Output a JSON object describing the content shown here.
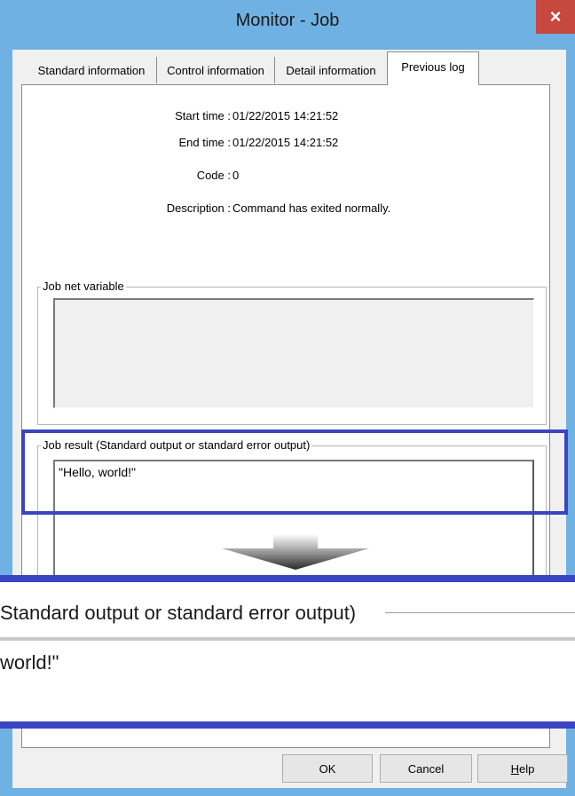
{
  "window": {
    "title": "Monitor - Job",
    "close_glyph": "×"
  },
  "tabs": [
    {
      "label": "Standard information",
      "active": false
    },
    {
      "label": "Control information",
      "active": false
    },
    {
      "label": "Detail information",
      "active": false
    },
    {
      "label": "Previous log",
      "active": true
    }
  ],
  "info": {
    "start_time_label": "Start time :",
    "start_time_value": "01/22/2015 14:21:52",
    "end_time_label": "End time :",
    "end_time_value": "01/22/2015 14:21:52",
    "code_label": "Code :",
    "code_value": "0",
    "description_label": "Description :",
    "description_value": "Command has exited normally."
  },
  "job_net_variable": {
    "title": "Job net variable",
    "value": ""
  },
  "job_result": {
    "title": "Job result (Standard output or standard error output)",
    "value": "\"Hello, world!\""
  },
  "zoom_callout": {
    "title_fragment": "Standard output or standard error output)",
    "value_fragment": "world!\""
  },
  "buttons": {
    "ok": "OK",
    "cancel": "Cancel",
    "help_first": "H",
    "help_rest": "elp"
  },
  "colors": {
    "highlight": "#3b44c2",
    "titlebar": "#6fb1e3",
    "close": "#c7483f"
  }
}
